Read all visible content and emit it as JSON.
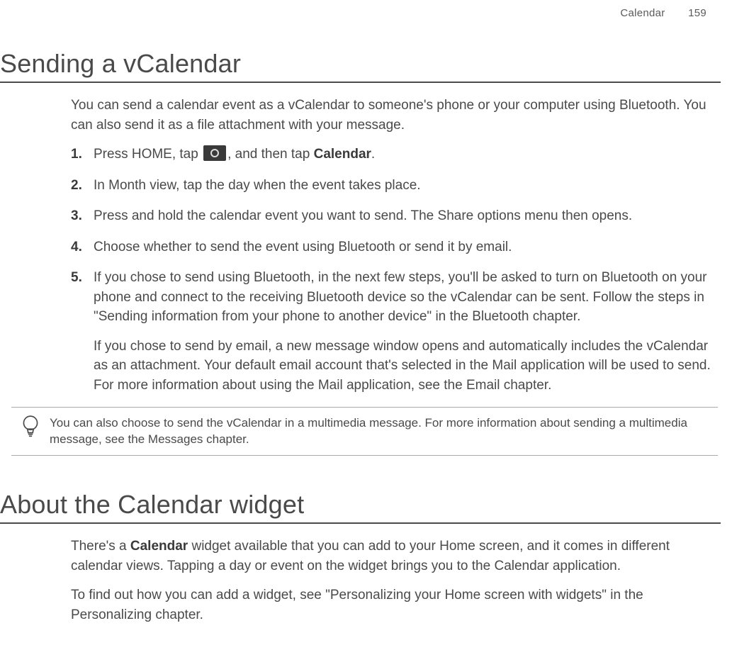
{
  "header": {
    "chapter": "Calendar",
    "page": "159"
  },
  "section1": {
    "title": "Sending a vCalendar",
    "intro": "You can send a calendar event as a vCalendar to someone's phone or your computer using Bluetooth. You can also send it as a file attachment with your message.",
    "step1_a": "Press HOME, tap ",
    "step1_b": ", and then tap ",
    "step1_bold": "Calendar",
    "step1_c": ".",
    "step2": "In Month view, tap the day when the event takes place.",
    "step3": "Press and hold the calendar event you want to send. The Share options menu then opens.",
    "step4": "Choose whether to send the event using Bluetooth or send it by email.",
    "step5": "If you chose to send using Bluetooth, in the next few steps, you'll be asked to turn on Bluetooth on your phone and connect to the receiving Bluetooth device so the vCalendar can be sent. Follow the steps in \"Sending information from your phone to another device\" in the Bluetooth chapter.",
    "step5_sub": "If you chose to send by email, a new message window opens and automatically includes the vCalendar as an attachment. Your default email account that's selected in the Mail application will be used to send. For more information about using the Mail application, see the Email chapter.",
    "tip": "You can also choose to send the vCalendar in a multimedia message. For more information about sending a multimedia message, see the Messages chapter."
  },
  "section2": {
    "title": "About the Calendar widget",
    "p1_a": "There's a ",
    "p1_bold": "Calendar",
    "p1_b": " widget available that you can add to your Home screen, and it comes in different calendar views. Tapping a day or event on the widget brings you to the Calendar application.",
    "p2": "To find out how you can add a widget, see \"Personalizing your Home screen with widgets\" in the Personalizing chapter."
  }
}
